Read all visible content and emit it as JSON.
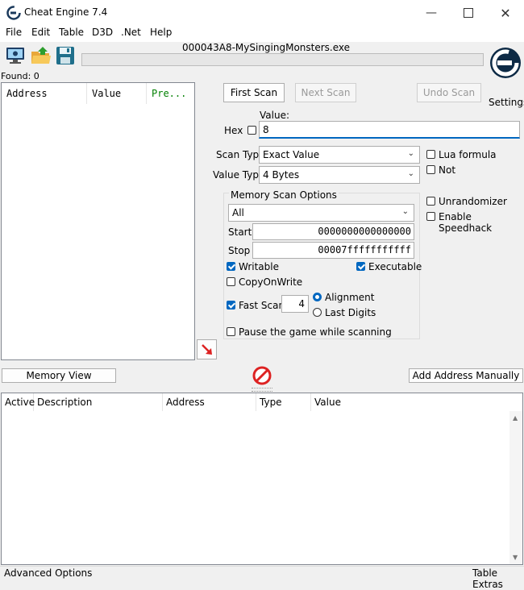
{
  "window": {
    "title": "Cheat Engine 7.4"
  },
  "menu": [
    "File",
    "Edit",
    "Table",
    "D3D",
    ".Net",
    "Help"
  ],
  "process": {
    "title": "000043A8-MySingingMonsters.exe"
  },
  "found": "Found: 0",
  "results": {
    "columns": [
      "Address",
      "Value",
      "Pre..."
    ]
  },
  "scan": {
    "first_scan": "First Scan",
    "next_scan": "Next Scan",
    "undo_scan": "Undo Scan",
    "settings": "Settings",
    "value_label": "Value:",
    "hex_label": "Hex",
    "value": "8",
    "scan_type_label": "Scan Type",
    "scan_type": "Exact Value",
    "value_type_label": "Value Type",
    "value_type": "4 Bytes",
    "lua_formula": "Lua formula",
    "not": "Not",
    "unrandomizer": "Unrandomizer",
    "enable_speedhack": "Enable Speedhack"
  },
  "memory_options": {
    "title": "Memory Scan Options",
    "region": "All",
    "start_label": "Start",
    "start": "0000000000000000",
    "stop_label": "Stop",
    "stop": "00007fffffffffff",
    "writable": "Writable",
    "executable": "Executable",
    "copy_on_write": "CopyOnWrite",
    "fast_scan": "Fast Scan",
    "fast_scan_value": "4",
    "alignment": "Alignment",
    "last_digits": "Last Digits",
    "pause_game": "Pause the game while scanning"
  },
  "buttons": {
    "memory_view": "Memory View",
    "add_address": "Add Address Manually"
  },
  "addrlist": {
    "columns": [
      "Active",
      "Description",
      "Address",
      "Type",
      "Value"
    ]
  },
  "status": {
    "advanced_options": "Advanced Options",
    "table_extras": "Table Extras"
  },
  "colors": {
    "accent": "#0067c0",
    "pre_header": "#008000"
  }
}
